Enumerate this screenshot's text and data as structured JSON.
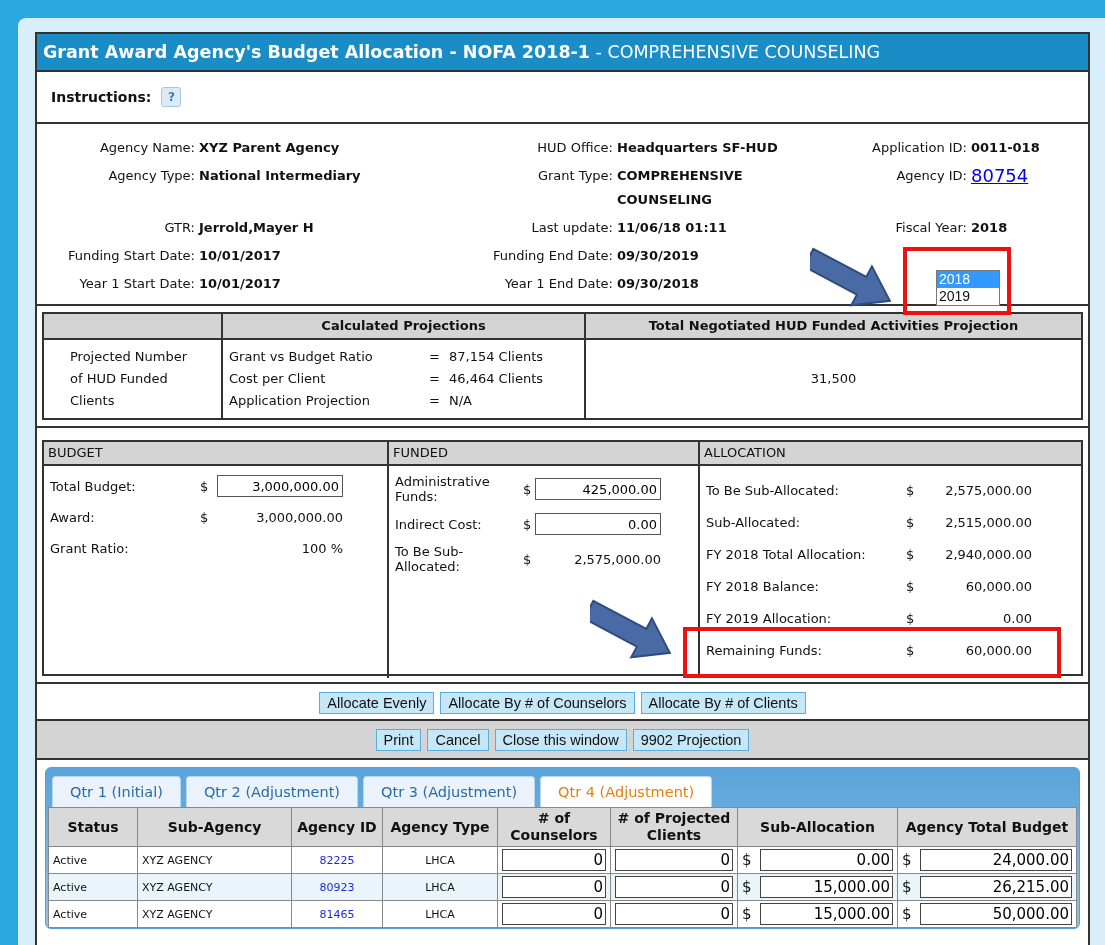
{
  "window": {
    "title": "**Grant Award Agency's Budget Allocation - NOFA 2018-1** - COMPREHENSIVE COUNSELING"
  },
  "instructions": {
    "label": "Instructions:",
    "help": "?"
  },
  "info": {
    "rows": [
      [
        {
          "label": "Agency Name:",
          "value": "XYZ Parent Agency",
          "kind": "text"
        },
        {
          "label": "HUD Office:",
          "value": "Headquarters SF-HUD",
          "kind": "text"
        },
        {
          "label": "Application ID:",
          "value": "0011-018",
          "kind": "text"
        }
      ],
      [
        {
          "label": "Agency Type:",
          "value": "National Intermediary",
          "kind": "text"
        },
        {
          "label": "Grant Type:",
          "value": "COMPREHENSIVE COUNSELING",
          "kind": "text"
        },
        {
          "label": "Agency ID:",
          "value": "80754",
          "kind": "link"
        }
      ],
      [
        {
          "label": "GTR:",
          "value": "Jerrold,Mayer H",
          "kind": "text"
        },
        {
          "label": "Last update:",
          "value": "11/06/18 01:11",
          "kind": "text"
        },
        {
          "label": "Fiscal Year:",
          "value": "2018",
          "kind": "text"
        }
      ],
      [
        {
          "label": "Funding Start Date:",
          "value": "10/01/2017",
          "kind": "text"
        },
        {
          "label": "Funding End Date:",
          "value": "09/30/2019",
          "kind": "text"
        }
      ],
      [
        {
          "label": "Year 1 Start Date:",
          "value": "10/01/2017",
          "kind": "text"
        },
        {
          "label": "Year 1 End Date:",
          "value": "09/30/2018",
          "kind": "text"
        }
      ]
    ]
  },
  "fiscal_year_list": {
    "options": [
      {
        "label": "2018",
        "selected": true
      },
      {
        "label": "2019",
        "selected": false
      }
    ]
  },
  "projections": {
    "columns": [
      "Calculated Projections",
      "Total Negotiated HUD Funded Activities Projection"
    ],
    "row_label": "Projected Number of HUD Funded Clients",
    "calculations": [
      {
        "label": "Grant vs Budget Ratio",
        "operator": "=",
        "value": "87,154 Clients"
      },
      {
        "label": "Cost per Client",
        "operator": "=",
        "value": "46,464 Clients"
      },
      {
        "label": "Application Projection",
        "operator": "=",
        "value": "N/A"
      }
    ],
    "negotiated": "31,500"
  },
  "panels": [
    {
      "title": "BUDGET",
      "rows": [
        {
          "label": "Total Budget:",
          "currency": "$",
          "value": "3,000,000.00",
          "kind": "field"
        },
        {
          "label": "Award:",
          "currency": "$",
          "value": "3,000,000.00",
          "kind": "text"
        },
        {
          "label": "Grant Ratio:",
          "value": "100 %",
          "kind": "text"
        }
      ]
    },
    {
      "title": "FUNDED",
      "rows": [
        {
          "label": "Administrative Funds:",
          "currency": "$",
          "value": "425,000.00",
          "kind": "field"
        },
        {
          "label": "Indirect Cost:",
          "currency": "$",
          "value": "0.00",
          "kind": "field"
        },
        {
          "label": "To Be Sub-Allocated:",
          "currency": "$",
          "value": "2,575,000.00",
          "kind": "text"
        }
      ]
    },
    {
      "title": "ALLOCATION",
      "rows": [
        {
          "label": "To Be Sub-Allocated:",
          "currency": "$",
          "value": "2,575,000.00",
          "kind": "text"
        },
        {
          "label": "Sub-Allocated:",
          "currency": "$",
          "value": "2,515,000.00",
          "kind": "text"
        },
        {
          "label": "FY 2018 Total Allocation:",
          "currency": "$",
          "value": "2,940,000.00",
          "kind": "text"
        },
        {
          "label": "FY 2018 Balance:",
          "currency": "$",
          "value": "60,000.00",
          "kind": "text"
        },
        {
          "label": "FY 2019 Allocation:",
          "currency": "$",
          "value": "0.00",
          "kind": "text"
        },
        {
          "label": "Remaining Funds:",
          "currency": "$",
          "value": "60,000.00",
          "kind": "text"
        }
      ]
    }
  ],
  "allocate_buttons": [
    "Allocate Evenly",
    "Allocate By # of Counselors",
    "Allocate By # of Clients"
  ],
  "action_buttons": [
    "Print",
    "Cancel",
    "Close this window",
    "9902 Projection"
  ],
  "tabs": [
    {
      "label": "Qtr 1 (Initial)",
      "selected": false
    },
    {
      "label": "Qtr 2 (Adjustment)",
      "selected": false
    },
    {
      "label": "Qtr 3 (Adjustment)",
      "selected": false
    },
    {
      "label": "Qtr 4 (Adjustment)",
      "selected": true
    }
  ],
  "table": {
    "columns": [
      "Status",
      "Sub-Agency",
      "Agency ID",
      "Agency Type",
      "# of Counselors",
      "# of Projected Clients",
      "Sub-Allocation",
      "Agency Total Budget"
    ],
    "rows": [
      [
        {
          "kind": "text",
          "value": "Active"
        },
        {
          "kind": "text",
          "value": "XYZ AGENCY"
        },
        {
          "kind": "link",
          "value": "82225"
        },
        {
          "kind": "center",
          "value": "LHCA"
        },
        {
          "kind": "field",
          "value": "0"
        },
        {
          "kind": "field",
          "value": "0"
        },
        {
          "kind": "money",
          "currency": "$",
          "value": "0.00"
        },
        {
          "kind": "money",
          "currency": "$",
          "value": "24,000.00"
        }
      ],
      [
        {
          "kind": "text",
          "value": "Active"
        },
        {
          "kind": "text",
          "value": "XYZ AGENCY"
        },
        {
          "kind": "link",
          "value": "80923"
        },
        {
          "kind": "center",
          "value": "LHCA"
        },
        {
          "kind": "field",
          "value": "0"
        },
        {
          "kind": "field",
          "value": "0"
        },
        {
          "kind": "money",
          "currency": "$",
          "value": "15,000.00"
        },
        {
          "kind": "money",
          "currency": "$",
          "value": "26,215.00"
        }
      ],
      [
        {
          "kind": "text",
          "value": "Active"
        },
        {
          "kind": "text",
          "value": "XYZ AGENCY"
        },
        {
          "kind": "link",
          "value": "81465"
        },
        {
          "kind": "center",
          "value": "LHCA"
        },
        {
          "kind": "field",
          "value": "0"
        },
        {
          "kind": "field",
          "value": "0"
        },
        {
          "kind": "money",
          "currency": "$",
          "value": "15,000.00"
        },
        {
          "kind": "money",
          "currency": "$",
          "value": "50,000.00"
        }
      ]
    ]
  },
  "annotations": [
    {
      "kind": "arrow"
    },
    {
      "kind": "highlight"
    },
    {
      "kind": "arrow"
    },
    {
      "kind": "highlight"
    }
  ]
}
